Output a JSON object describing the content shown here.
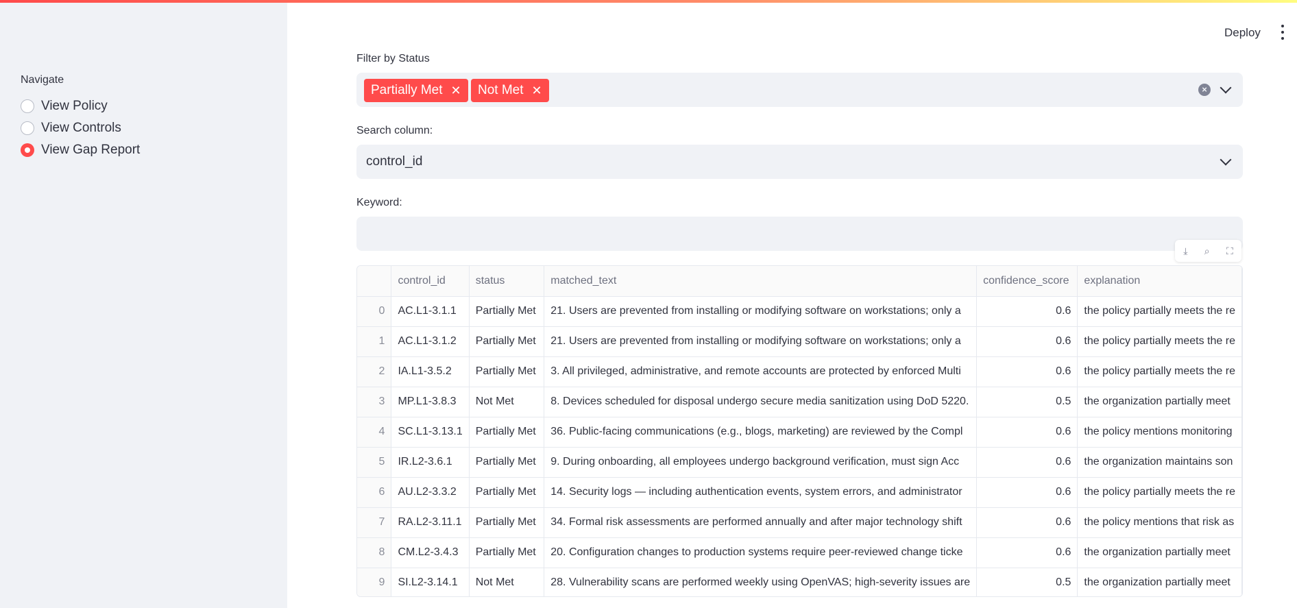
{
  "sidebar": {
    "nav_label": "Navigate",
    "items": [
      {
        "label": "View Policy",
        "selected": false
      },
      {
        "label": "View Controls",
        "selected": false
      },
      {
        "label": "View Gap Report",
        "selected": true
      }
    ]
  },
  "header": {
    "deploy_label": "Deploy"
  },
  "filter": {
    "label": "Filter by Status",
    "chips": [
      "Partially Met",
      "Not Met"
    ]
  },
  "search_column": {
    "label": "Search column:",
    "value": "control_id"
  },
  "keyword": {
    "label": "Keyword:",
    "value": ""
  },
  "toolbar": {
    "icons": [
      "download-icon",
      "search-icon",
      "fullscreen-icon"
    ]
  },
  "table": {
    "columns": [
      "",
      "control_id",
      "status",
      "matched_text",
      "confidence_score",
      "explanation"
    ],
    "rows": [
      [
        "0",
        "AC.L1-3.1.1",
        "Partially Met",
        "21. Users are prevented from installing or modifying software on workstations; only a",
        "0.6",
        "the policy partially meets the re"
      ],
      [
        "1",
        "AC.L1-3.1.2",
        "Partially Met",
        "21. Users are prevented from installing or modifying software on workstations; only a",
        "0.6",
        "the policy partially meets the re"
      ],
      [
        "2",
        "IA.L1-3.5.2",
        "Partially Met",
        "3. All privileged, administrative, and remote accounts are protected by enforced Multi",
        "0.6",
        "the policy partially meets the re"
      ],
      [
        "3",
        "MP.L1-3.8.3",
        "Not Met",
        "8. Devices scheduled for disposal undergo secure media sanitization using DoD 5220.",
        "0.5",
        "the organization partially meet"
      ],
      [
        "4",
        "SC.L1-3.13.1",
        "Partially Met",
        "36. Public-facing communications (e.g., blogs, marketing) are reviewed by the Compl",
        "0.6",
        "the policy mentions monitoring"
      ],
      [
        "5",
        "IR.L2-3.6.1",
        "Partially Met",
        "9. During onboarding, all employees undergo background verification, must sign Acc",
        "0.6",
        "the organization maintains son"
      ],
      [
        "6",
        "AU.L2-3.3.2",
        "Partially Met",
        "14. Security logs — including authentication events, system errors, and administrator",
        "0.6",
        "the policy partially meets the re"
      ],
      [
        "7",
        "RA.L2-3.11.1",
        "Partially Met",
        "34. Formal risk assessments are performed annually and after major technology shift",
        "0.6",
        "the policy mentions that risk as"
      ],
      [
        "8",
        "CM.L2-3.4.3",
        "Partially Met",
        "20. Configuration changes to production systems require peer-reviewed change ticke",
        "0.6",
        "the organization partially meet"
      ],
      [
        "9",
        "SI.L2-3.14.1",
        "Not Met",
        "28. Vulnerability scans are performed weekly using OpenVAS; high-severity issues are",
        "0.5",
        "the organization partially meet"
      ]
    ]
  },
  "colors": {
    "accent": "#ff4b4b",
    "sidebar_bg": "#f0f2f6",
    "text": "#31333f"
  }
}
